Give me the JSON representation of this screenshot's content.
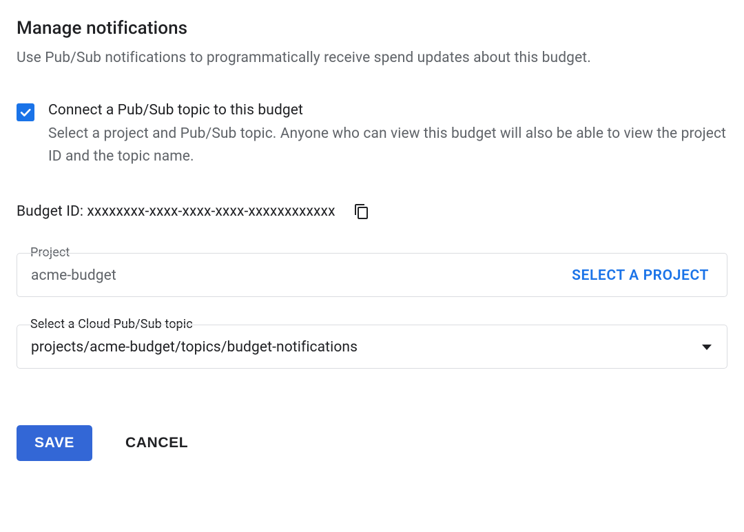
{
  "header": {
    "title": "Manage notifications",
    "subtitle": "Use Pub/Sub notifications to programmatically receive spend updates about this budget."
  },
  "checkbox": {
    "label": "Connect a Pub/Sub topic to this budget",
    "helper": "Select a project and Pub/Sub topic. Anyone who can view this budget will also be able to view the project ID and the topic name."
  },
  "budget_id": {
    "label": "Budget ID: ",
    "value": "xxxxxxxx-xxxx-xxxx-xxxx-xxxxxxxxxxxx"
  },
  "project_field": {
    "label": "Project",
    "value": "acme-budget",
    "action": "SELECT A PROJECT"
  },
  "topic_field": {
    "label": "Select a Cloud Pub/Sub topic",
    "value": "projects/acme-budget/topics/budget-notifications"
  },
  "buttons": {
    "save": "SAVE",
    "cancel": "CANCEL"
  }
}
